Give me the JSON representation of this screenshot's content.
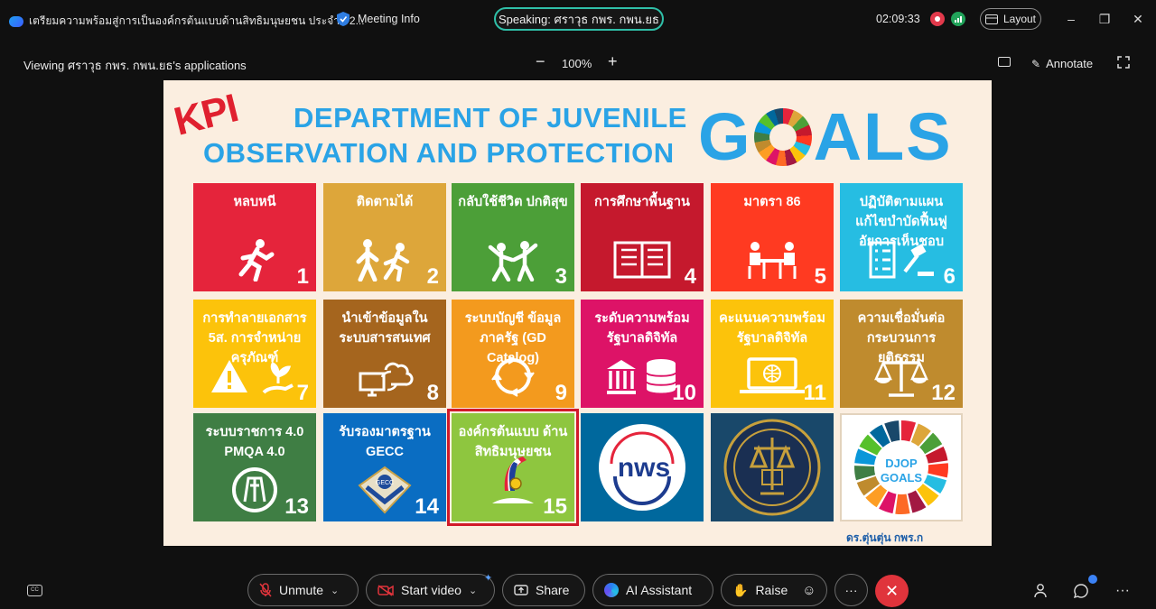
{
  "titlebar": {
    "app_title": "เตรียมความพร้อมสู่การเป็นองค์กรต้นแบบด้านสิทธิมนุษยชน ประจำปี 2...",
    "meeting_info": "Meeting Info",
    "speaking": "Speaking: ศราวุธ กพร. กพน.ยธ",
    "time": "02:09:33",
    "layout": "Layout"
  },
  "viewbar": {
    "viewing": "Viewing ศราวุธ กพร. กพน.ยธ's applications",
    "zoom": "100%",
    "annotate": "Annotate"
  },
  "slide": {
    "kpi": "KPI",
    "dept_line1": "DEPARTMENT OF JUVENILE",
    "dept_line2": "OBSERVATION AND PROTECTION",
    "goals_left": "G",
    "goals_right": "ALS",
    "credit": "ดร.ตุ่นตุ่น กพร.ก",
    "tiles": [
      {
        "label": "หลบหนี",
        "num": "1",
        "color": "#e5243b",
        "icon": "running-person-icon"
      },
      {
        "label": "ติดตามได้",
        "num": "2",
        "color": "#dda63a",
        "icon": "two-people-icon"
      },
      {
        "label": "กลับใช้ชีวิต ปกติสุข",
        "num": "3",
        "color": "#4c9f38",
        "icon": "celebrating-people-icon"
      },
      {
        "label": "การศึกษาพื้นฐาน",
        "num": "4",
        "color": "#c5192d",
        "icon": "open-book-icon"
      },
      {
        "label": "มาตรา 86",
        "num": "5",
        "color": "#ff3a21",
        "icon": "meeting-table-icon"
      },
      {
        "label": "ปฏิบัติตามแผน แก้ไขบำบัดฟื้นฟู อัยการเห็นชอบ",
        "num": "6",
        "color": "#26bde2",
        "icon": "checklist-gavel-icon"
      },
      {
        "label": "การทำลายเอกสาร 5ส. การจำหน่ายครุภัณฑ์",
        "num": "7",
        "color": "#fcc30b",
        "icon": "warning-plant-icon"
      },
      {
        "label": "นำเข้าข้อมูลใน ระบบสารสนเทศ",
        "num": "8",
        "color": "#a5651e",
        "icon": "cloud-computer-icon"
      },
      {
        "label": "ระบบบัญชี ข้อมูลภาครัฐ (GD Catalog)",
        "num": "9",
        "color": "#f39a1e",
        "icon": "recycle-arrows-icon"
      },
      {
        "label": "ระดับความพร้อม รัฐบาลดิจิทัล",
        "num": "10",
        "color": "#dd1367",
        "icon": "bank-database-icon"
      },
      {
        "label": "คะแนนความพร้อม รัฐบาลดิจิทัล",
        "num": "11",
        "color": "#fcc30b",
        "icon": "laptop-globe-icon"
      },
      {
        "label": "ความเชื่อมั่นต่อ กระบวนการยุติธรรม",
        "num": "12",
        "color": "#bf8b2e",
        "icon": "scales-icon"
      },
      {
        "label": "ระบบราชการ 4.0 PMQA 4.0",
        "num": "13",
        "color": "#3f7e44",
        "icon": "pmqa-logo-icon"
      },
      {
        "label": "รับรองมาตรฐาน GECC",
        "num": "14",
        "color": "#0a6dc2",
        "icon": "gecc-badge-icon"
      },
      {
        "label": "องค์กรต้นแบบ ด้านสิทธิมนุษยชน",
        "num": "15",
        "color": "#8ec63f",
        "icon": "human-rights-logo-icon"
      },
      {
        "label": "nws",
        "num": "",
        "color": "#00689d",
        "icon": "nws-logo"
      },
      {
        "label": "",
        "num": "",
        "color": "#19486a",
        "icon": "ministry-seal"
      },
      {
        "label": "DJOP GOALS",
        "num": "",
        "color": "#ffffff",
        "icon": "djop-goals-wheel"
      }
    ]
  },
  "controls": {
    "unmute": "Unmute",
    "start_video": "Start video",
    "share": "Share",
    "ai_assistant": "AI Assistant",
    "raise": "Raise"
  }
}
